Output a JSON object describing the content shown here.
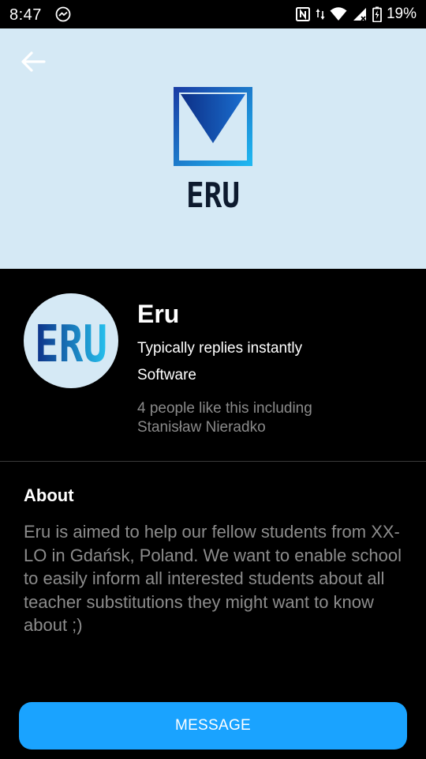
{
  "status_bar": {
    "time": "8:47",
    "battery": "19%",
    "icons": [
      "messenger-icon",
      "nfc-icon",
      "data-arrows-icon",
      "wifi-icon",
      "cell-signal-icon",
      "battery-icon"
    ]
  },
  "header": {
    "back_icon": "arrow-left-icon",
    "logo_text": "ERU",
    "cover_color": "#d5e9f5"
  },
  "profile": {
    "avatar_text": "ERU",
    "name": "Eru",
    "reply_time": "Typically replies instantly",
    "category": "Software",
    "likes_line1": "4 people like this including",
    "likes_line2": "Stanisław Nieradko"
  },
  "about": {
    "heading": "About",
    "text": "Eru is aimed to help our fellow students from XX-LO in Gdańsk, Poland. We want to enable school to easily inform all interested students about all teacher substitutions they might want to know about ;)"
  },
  "actions": {
    "message_label": "MESSAGE",
    "accent_color": "#1aa3ff"
  }
}
